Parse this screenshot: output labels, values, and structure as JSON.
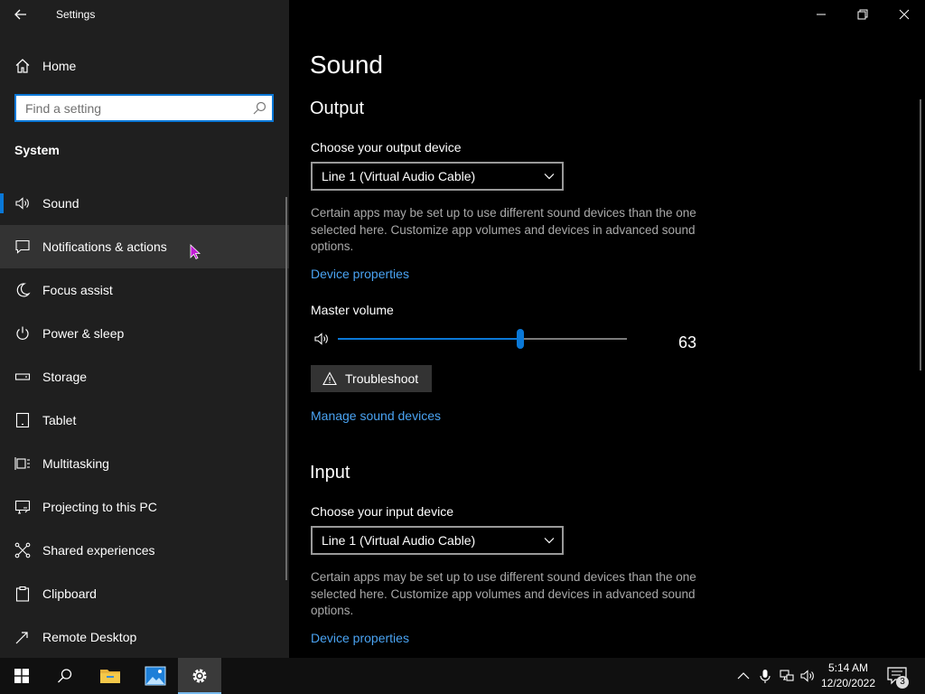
{
  "window": {
    "title": "Settings"
  },
  "sidebar": {
    "home_label": "Home",
    "search_placeholder": "Find a setting",
    "section_label": "System",
    "items": [
      {
        "label": "Sound",
        "icon": "speaker-icon",
        "selected": true
      },
      {
        "label": "Notifications & actions",
        "icon": "message-icon",
        "hover": true
      },
      {
        "label": "Focus assist",
        "icon": "moon-icon"
      },
      {
        "label": "Power & sleep",
        "icon": "power-icon"
      },
      {
        "label": "Storage",
        "icon": "storage-icon"
      },
      {
        "label": "Tablet",
        "icon": "tablet-icon"
      },
      {
        "label": "Multitasking",
        "icon": "multitasking-icon"
      },
      {
        "label": "Projecting to this PC",
        "icon": "projecting-icon"
      },
      {
        "label": "Shared experiences",
        "icon": "shared-icon"
      },
      {
        "label": "Clipboard",
        "icon": "clipboard-icon"
      },
      {
        "label": "Remote Desktop",
        "icon": "remote-desktop-icon"
      }
    ]
  },
  "main": {
    "page_title": "Sound",
    "output": {
      "title": "Output",
      "device_label": "Choose your output device",
      "device_value": "Line 1 (Virtual Audio Cable)",
      "description": "Certain apps may be set up to use different sound devices than the one selected here. Customize app volumes and devices in advanced sound options.",
      "device_properties_link": "Device properties",
      "master_volume_label": "Master volume",
      "volume_value": "63",
      "volume_level": 63,
      "troubleshoot_label": "Troubleshoot",
      "manage_devices_link": "Manage sound devices"
    },
    "input": {
      "title": "Input",
      "device_label": "Choose your input device",
      "device_value": "Line 1 (Virtual Audio Cable)",
      "description": "Certain apps may be set up to use different sound devices than the one selected here. Customize app volumes and devices in advanced sound options.",
      "device_properties_link": "Device properties"
    }
  },
  "taskbar": {
    "time": "5:14 AM",
    "date": "12/20/2022",
    "notification_count": "3"
  },
  "colors": {
    "accent": "#0a78d7",
    "link": "#4aa3f2",
    "sidebar_bg": "#1f1f1f",
    "main_bg": "#000000"
  }
}
